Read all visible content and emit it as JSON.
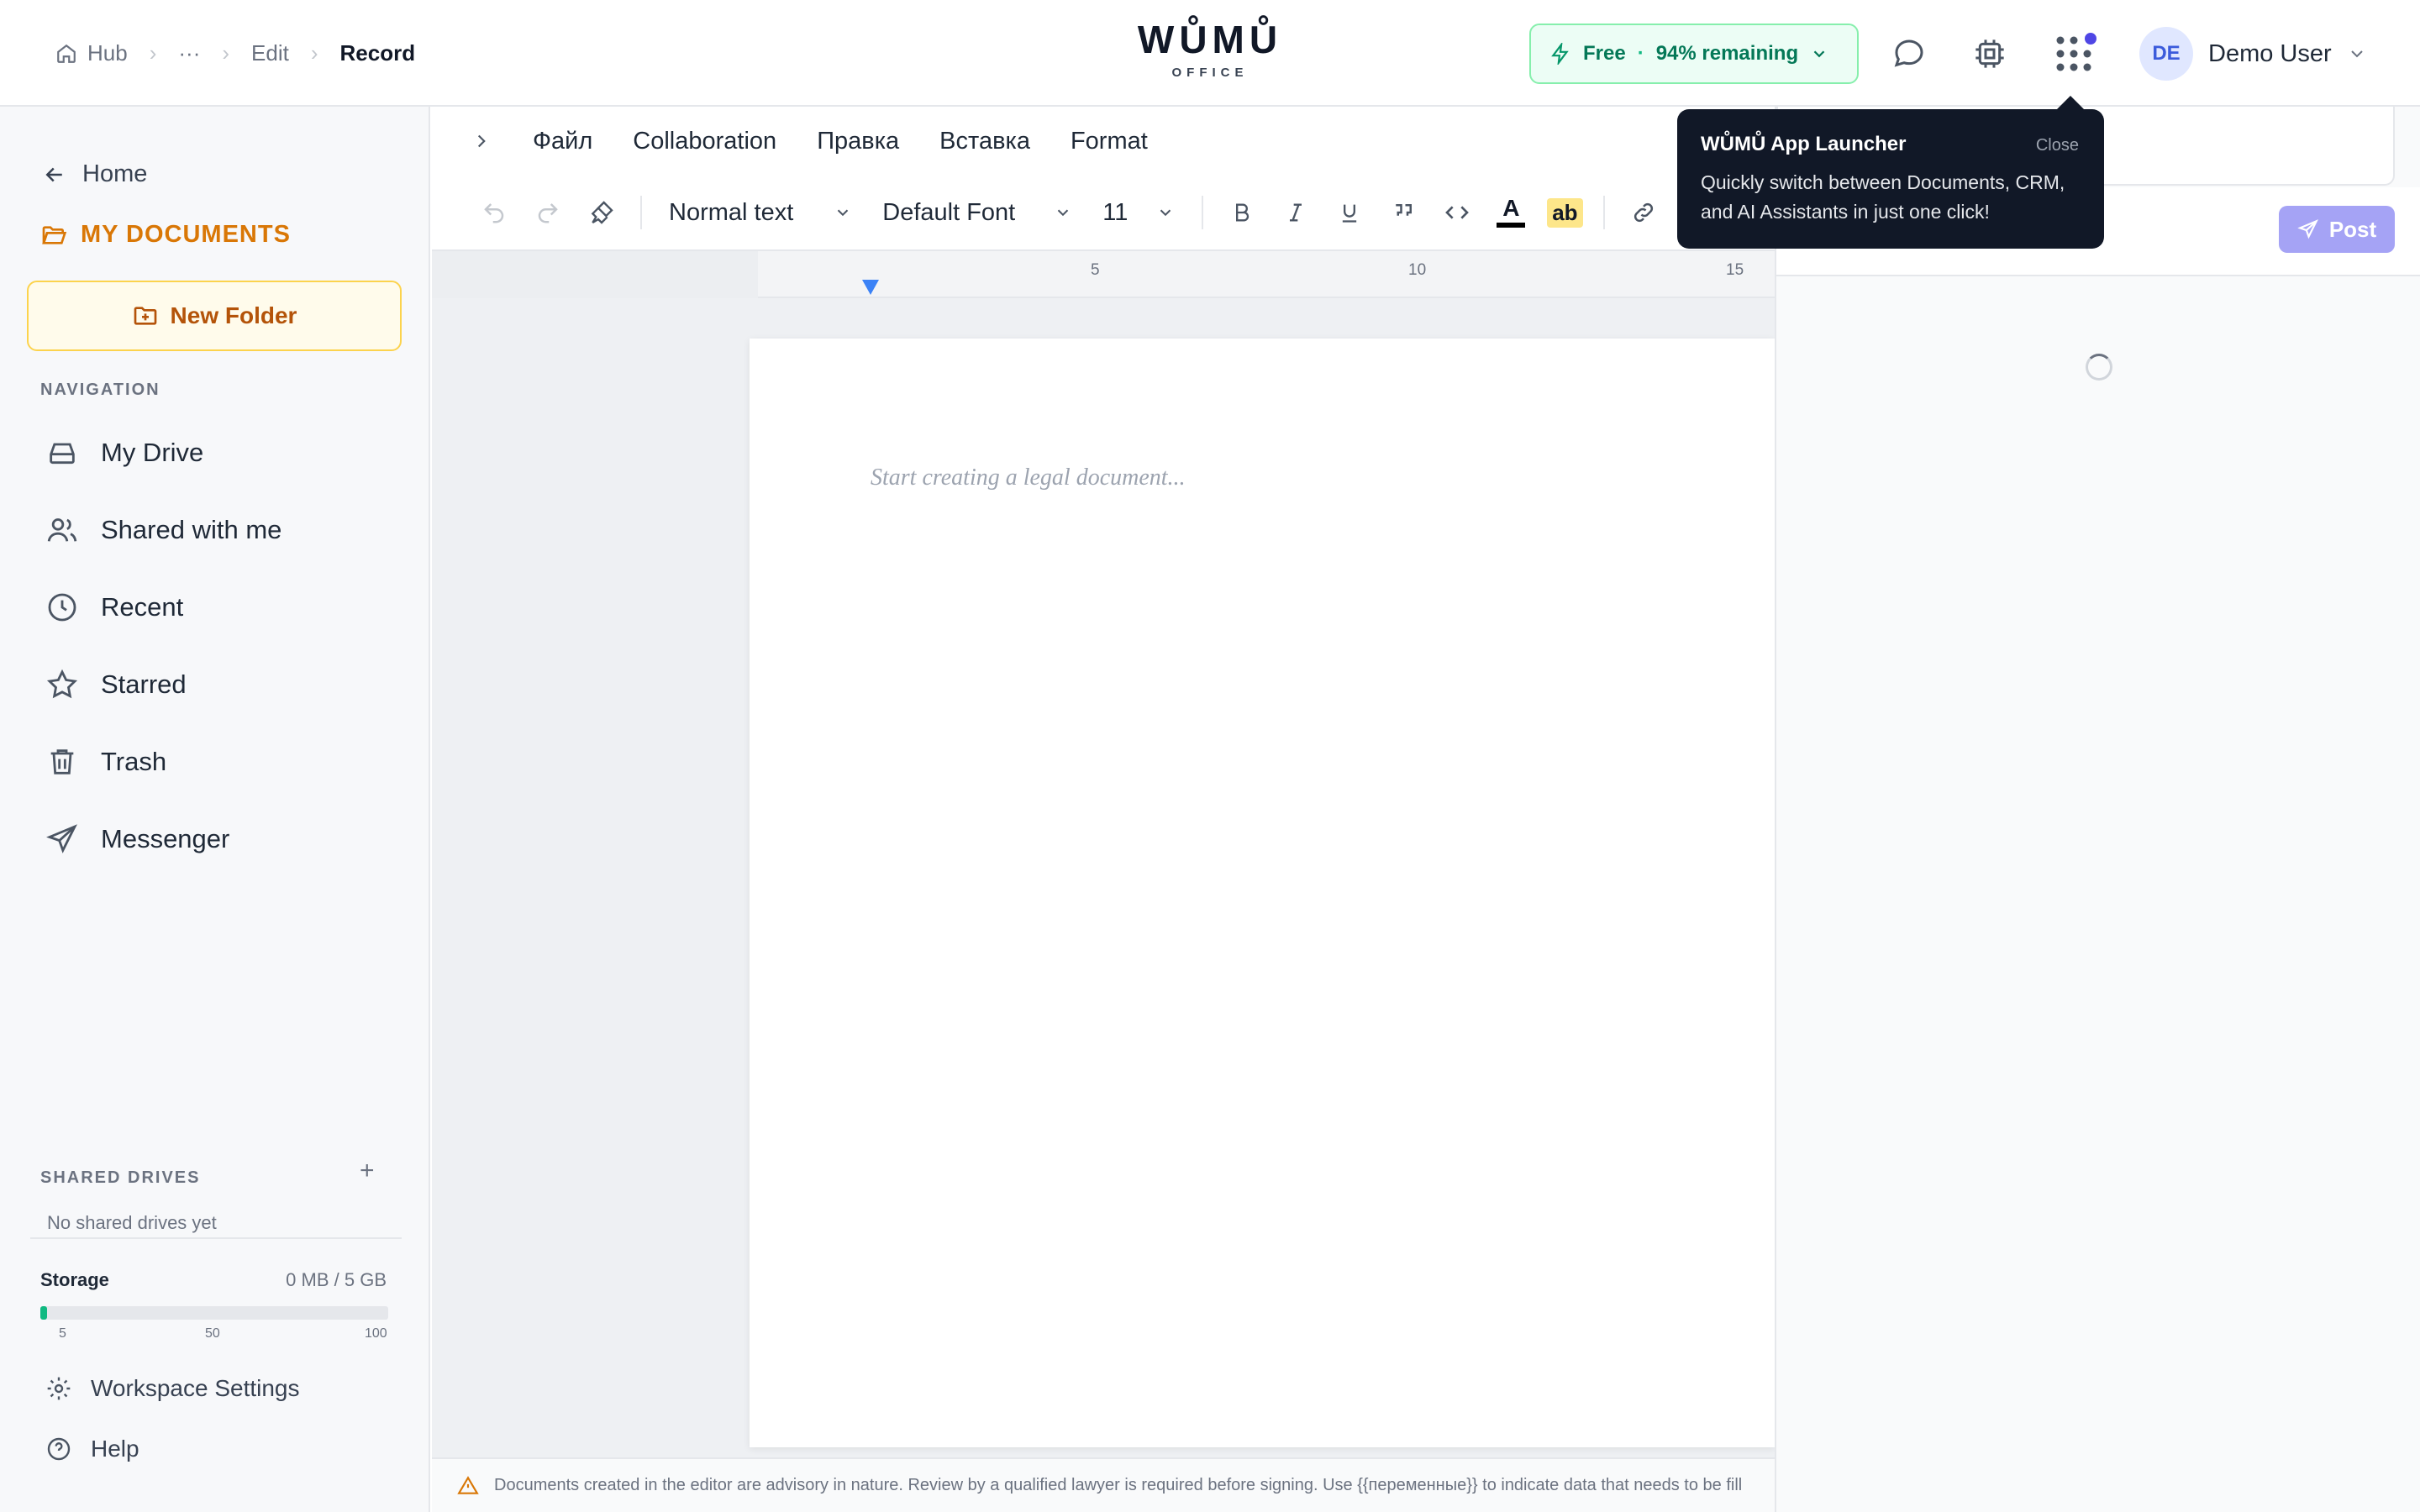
{
  "breadcrumb": {
    "hub": "Hub",
    "ellipsis": "···",
    "edit": "Edit",
    "current": "Record"
  },
  "logo": {
    "brand": "WŮMŮ",
    "sub": "OFFICE"
  },
  "plan": {
    "tier": "Free",
    "separator": "·",
    "remaining": "94% remaining"
  },
  "user": {
    "initials": "DE",
    "name": "Demo User"
  },
  "sidebar": {
    "home": "Home",
    "my_documents": "MY DOCUMENTS",
    "new_folder": "New Folder",
    "nav_label": "NAVIGATION",
    "items": [
      {
        "label": "My Drive",
        "icon": "drive-icon"
      },
      {
        "label": "Shared with me",
        "icon": "users-icon"
      },
      {
        "label": "Recent",
        "icon": "clock-icon"
      },
      {
        "label": "Starred",
        "icon": "star-icon"
      },
      {
        "label": "Trash",
        "icon": "trash-icon"
      },
      {
        "label": "Messenger",
        "icon": "send-icon"
      }
    ],
    "shared_drives_label": "SHARED DRIVES",
    "shared_drives_add": "+",
    "no_shared_drives": "No shared drives yet",
    "storage": {
      "label": "Storage",
      "value": "0 MB / 5 GB",
      "used_fraction": 0.02,
      "ticks": [
        "5",
        "50",
        "100"
      ]
    },
    "workspace_settings": "Workspace Settings",
    "help": "Help"
  },
  "menu": [
    "Файл",
    "Collaboration",
    "Правка",
    "Вставка",
    "Format"
  ],
  "toolbar": {
    "paragraph_style": "Normal text",
    "font": "Default Font",
    "font_size": "11",
    "text_color_glyph": "A",
    "highlight_glyph": "ab"
  },
  "ruler": {
    "marks": [
      "5",
      "10",
      "15"
    ]
  },
  "document": {
    "placeholder": "Start creating a legal document..."
  },
  "footer_note": "Documents created in the editor are advisory in nature. Review by a qualified lawyer is required before signing. Use {{переменные}} to indicate data that needs to be fill",
  "right_panel": {
    "post_label": "Post"
  },
  "tooltip": {
    "title": "WŮMŮ App Launcher",
    "close": "Close",
    "body": "Quickly switch between Documents, CRM, and AI Assistants in just one click!"
  },
  "colors": {
    "accent_amber": "#d97706",
    "plan_green": "#047857",
    "post_purple": "#a5a3f5",
    "avatar_blue": "#3b5bdb"
  }
}
